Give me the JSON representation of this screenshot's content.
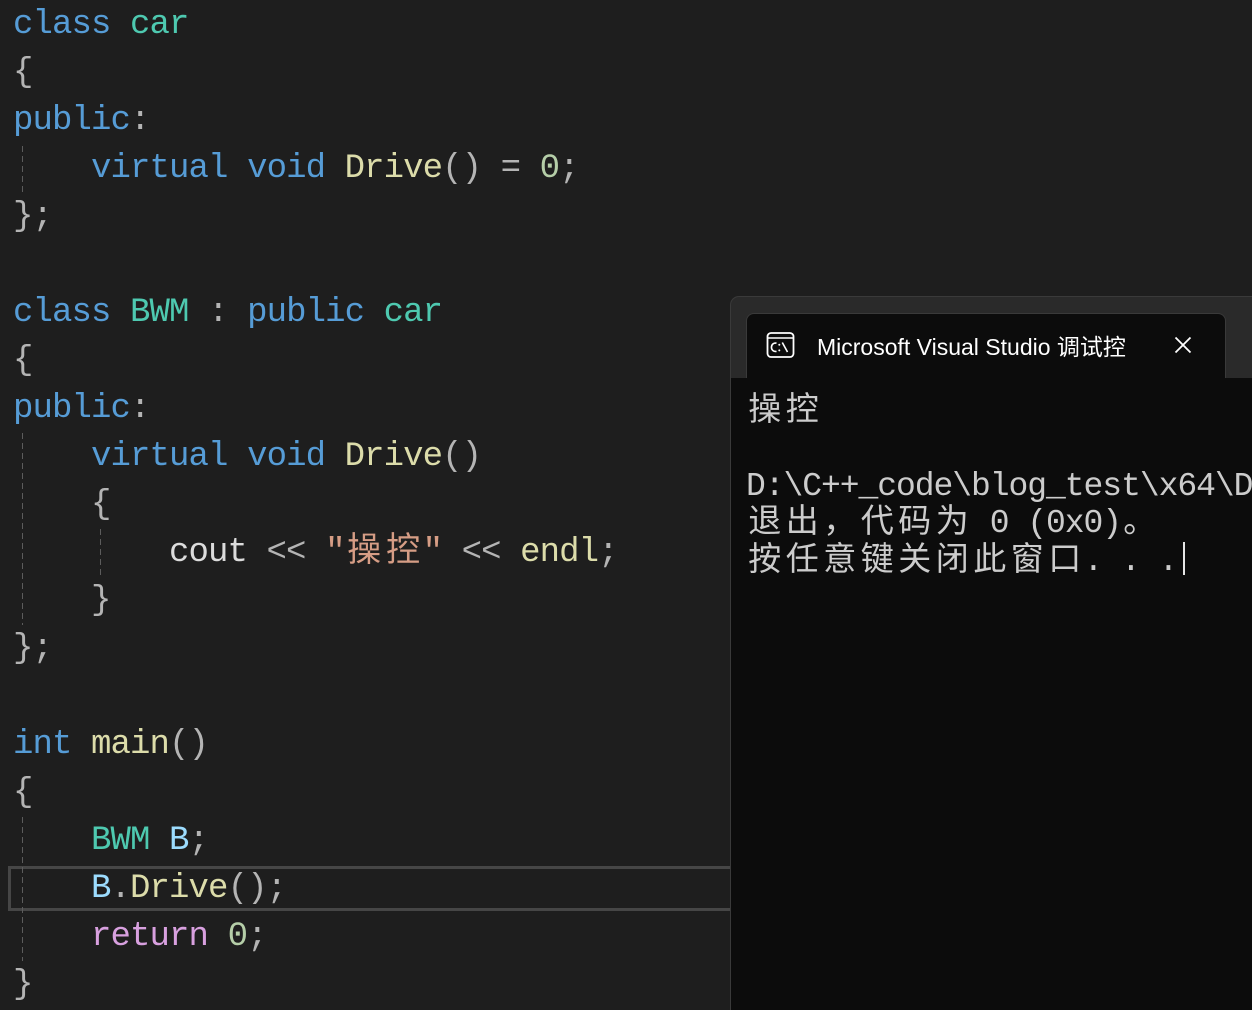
{
  "editor": {
    "lines": [
      {
        "tokens": [
          {
            "text": "class",
            "kind": "keyword"
          },
          {
            "text": " ",
            "kind": "space"
          },
          {
            "text": "car",
            "kind": "type"
          }
        ]
      },
      {
        "tokens": [
          {
            "text": "{",
            "kind": "punct"
          }
        ]
      },
      {
        "tokens": [
          {
            "text": "public",
            "kind": "keyword"
          },
          {
            "text": ":",
            "kind": "punct"
          }
        ]
      },
      {
        "tokens": [
          {
            "text": "    ",
            "kind": "space"
          },
          {
            "text": "virtual",
            "kind": "keyword"
          },
          {
            "text": " ",
            "kind": "space"
          },
          {
            "text": "void",
            "kind": "keyword"
          },
          {
            "text": " ",
            "kind": "space"
          },
          {
            "text": "Drive",
            "kind": "function"
          },
          {
            "text": "()",
            "kind": "punct"
          },
          {
            "text": " = ",
            "kind": "punct"
          },
          {
            "text": "0",
            "kind": "number"
          },
          {
            "text": ";",
            "kind": "punct"
          }
        ]
      },
      {
        "tokens": [
          {
            "text": "};",
            "kind": "punct"
          }
        ]
      },
      {
        "tokens": []
      },
      {
        "tokens": [
          {
            "text": "class",
            "kind": "keyword"
          },
          {
            "text": " ",
            "kind": "space"
          },
          {
            "text": "BWM",
            "kind": "type"
          },
          {
            "text": " : ",
            "kind": "punct"
          },
          {
            "text": "public",
            "kind": "keyword"
          },
          {
            "text": " ",
            "kind": "space"
          },
          {
            "text": "car",
            "kind": "type"
          }
        ]
      },
      {
        "tokens": [
          {
            "text": "{",
            "kind": "punct"
          }
        ]
      },
      {
        "tokens": [
          {
            "text": "public",
            "kind": "keyword"
          },
          {
            "text": ":",
            "kind": "punct"
          }
        ]
      },
      {
        "tokens": [
          {
            "text": "    ",
            "kind": "space"
          },
          {
            "text": "virtual",
            "kind": "keyword"
          },
          {
            "text": " ",
            "kind": "space"
          },
          {
            "text": "void",
            "kind": "keyword"
          },
          {
            "text": " ",
            "kind": "space"
          },
          {
            "text": "Drive",
            "kind": "function"
          },
          {
            "text": "()",
            "kind": "punct"
          }
        ]
      },
      {
        "tokens": [
          {
            "text": "    ",
            "kind": "space"
          },
          {
            "text": "{",
            "kind": "punct"
          }
        ]
      },
      {
        "tokens": [
          {
            "text": "        ",
            "kind": "space"
          },
          {
            "text": "cout",
            "kind": "variable"
          },
          {
            "text": " << ",
            "kind": "punct"
          },
          {
            "text": "\"操控\"",
            "kind": "string"
          },
          {
            "text": " << ",
            "kind": "punct"
          },
          {
            "text": "endl",
            "kind": "function"
          },
          {
            "text": ";",
            "kind": "punct"
          }
        ]
      },
      {
        "tokens": [
          {
            "text": "    ",
            "kind": "space"
          },
          {
            "text": "}",
            "kind": "punct"
          }
        ]
      },
      {
        "tokens": [
          {
            "text": "};",
            "kind": "punct"
          }
        ]
      },
      {
        "tokens": []
      },
      {
        "tokens": [
          {
            "text": "int",
            "kind": "keyword"
          },
          {
            "text": " ",
            "kind": "space"
          },
          {
            "text": "main",
            "kind": "function"
          },
          {
            "text": "()",
            "kind": "punct"
          }
        ]
      },
      {
        "tokens": [
          {
            "text": "{",
            "kind": "punct"
          }
        ]
      },
      {
        "tokens": [
          {
            "text": "    ",
            "kind": "space"
          },
          {
            "text": "BWM",
            "kind": "type"
          },
          {
            "text": " ",
            "kind": "space"
          },
          {
            "text": "B",
            "kind": "local"
          },
          {
            "text": ";",
            "kind": "punct"
          }
        ]
      },
      {
        "current": true,
        "tokens": [
          {
            "text": "    ",
            "kind": "space"
          },
          {
            "text": "B",
            "kind": "local"
          },
          {
            "text": ".",
            "kind": "punct"
          },
          {
            "text": "Drive",
            "kind": "function"
          },
          {
            "text": "();",
            "kind": "punct"
          }
        ]
      },
      {
        "tokens": [
          {
            "text": "    ",
            "kind": "space"
          },
          {
            "text": "return",
            "kind": "control"
          },
          {
            "text": " ",
            "kind": "space"
          },
          {
            "text": "0",
            "kind": "number"
          },
          {
            "text": ";",
            "kind": "punct"
          }
        ]
      },
      {
        "tokens": [
          {
            "text": "}",
            "kind": "punct"
          }
        ]
      }
    ]
  },
  "console": {
    "icon": "terminal-icon",
    "title": "Microsoft Visual Studio 调试控",
    "close_icon": "close-icon",
    "lines": [
      "操控",
      "",
      "D:\\C++_code\\blog_test\\x64\\D",
      "退出，代码为 0 (0x0)。",
      "按任意键关闭此窗口. . ."
    ]
  },
  "theme": {
    "editor_background": "#1E1E1E",
    "keyword": "#569CD6",
    "control_keyword": "#D8A0DF",
    "type": "#4EC9B0",
    "function": "#DCDCAA",
    "number": "#B5CEA8",
    "string": "#D69D85",
    "punctuation": "#B4B4B4",
    "variable": "#DCDCDC",
    "local_variable": "#9CDCFE",
    "console_background": "#0C0C0C",
    "console_text": "#CCCCCC"
  }
}
